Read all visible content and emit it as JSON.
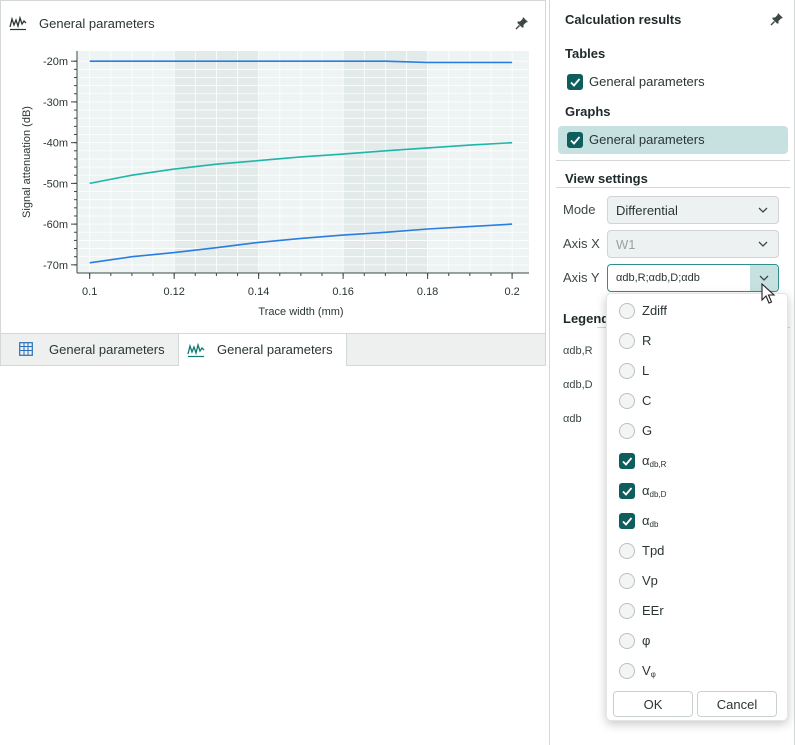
{
  "chart_panel": {
    "title": "General parameters",
    "tabs": [
      {
        "label": "General parameters",
        "icon": "table-icon"
      },
      {
        "label": "General parameters",
        "icon": "chart-wave-icon"
      }
    ]
  },
  "chart_data": {
    "type": "line",
    "title": "",
    "xlabel": "Trace width (mm)",
    "ylabel": "Signal attenuation (dB)",
    "xlim": [
      0.1,
      0.2
    ],
    "ylim": [
      -70,
      -20
    ],
    "x_ticks": [
      "0.1",
      "0.12",
      "0.14",
      "0.16",
      "0.18",
      "0.2"
    ],
    "y_ticks": [
      "-20m",
      "-30m",
      "-40m",
      "-50m",
      "-60m",
      "-70m"
    ],
    "x": [
      0.1,
      0.11,
      0.12,
      0.13,
      0.14,
      0.15,
      0.16,
      0.17,
      0.18,
      0.19,
      0.2
    ],
    "series": [
      {
        "color": "#2a7de1",
        "values": [
          -20,
          -20,
          -20,
          -20,
          -20,
          -20,
          -20,
          -20,
          -20.3,
          -20.3,
          -20.3
        ]
      },
      {
        "color": "#1fb5a8",
        "values": [
          -50,
          -48,
          -46.5,
          -45.3,
          -44.4,
          -43.5,
          -42.8,
          -42,
          -41.3,
          -40.6,
          -40
        ]
      },
      {
        "color": "#2a7de1",
        "values": [
          -69.5,
          -68,
          -67,
          -65.8,
          -64.5,
          -63.5,
          -62.7,
          -62,
          -61.2,
          -60.6,
          -60
        ]
      }
    ]
  },
  "results": {
    "title": "Calculation results",
    "tables_heading": "Tables",
    "tables_item": "General parameters",
    "graphs_heading": "Graphs",
    "graphs_item": "General parameters",
    "view_settings": "View settings",
    "mode_label": "Mode",
    "mode_value": "Differential",
    "axis_x_label": "Axis X",
    "axis_x_value": "W1",
    "axis_y_label": "Axis Y",
    "axis_y_value": "αdb,R;αdb,D;αdb",
    "legend_heading": "Legend",
    "legend_items": [
      "αdb,R",
      "αdb,D",
      "αdb"
    ]
  },
  "dropdown": {
    "options": [
      {
        "label": "Zdiff",
        "checked": false
      },
      {
        "label": "R",
        "checked": false
      },
      {
        "label": "L",
        "checked": false
      },
      {
        "label": "C",
        "checked": false
      },
      {
        "label": "G",
        "checked": false
      },
      {
        "label": "α",
        "sub": "db,R",
        "checked": true
      },
      {
        "label": "α",
        "sub": "db,D",
        "checked": true
      },
      {
        "label": "α",
        "sub": "db",
        "checked": true
      },
      {
        "label": "Tpd",
        "checked": false
      },
      {
        "label": "Vp",
        "checked": false
      },
      {
        "label": "EEr",
        "checked": false
      },
      {
        "label": "φ",
        "checked": false
      },
      {
        "label": "V",
        "sub": "φ",
        "checked": false
      }
    ],
    "ok": "OK",
    "cancel": "Cancel"
  }
}
